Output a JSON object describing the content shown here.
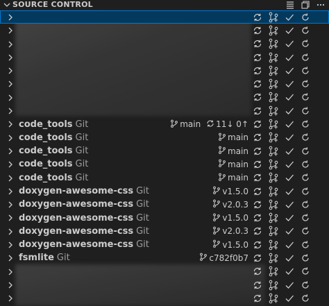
{
  "header": {
    "title": "SOURCE CONTROL"
  },
  "rows": [
    {
      "name": "",
      "kind": "",
      "branch": "",
      "sync": ""
    },
    {
      "name": "",
      "kind": "",
      "branch": "",
      "sync": ""
    },
    {
      "name": "",
      "kind": "",
      "branch": "",
      "sync": ""
    },
    {
      "name": "",
      "kind": "",
      "branch": "",
      "sync": ""
    },
    {
      "name": "",
      "kind": "",
      "branch": "",
      "sync": ""
    },
    {
      "name": "",
      "kind": "",
      "branch": "",
      "sync": ""
    },
    {
      "name": "",
      "kind": "",
      "branch": "",
      "sync": ""
    },
    {
      "name": "",
      "kind": "",
      "branch": "",
      "sync": ""
    },
    {
      "name": "code_tools",
      "kind": "Git",
      "branch": "main",
      "sync": "11↓ 0↑"
    },
    {
      "name": "code_tools",
      "kind": "Git",
      "branch": "main",
      "sync": ""
    },
    {
      "name": "code_tools",
      "kind": "Git",
      "branch": "main",
      "sync": ""
    },
    {
      "name": "code_tools",
      "kind": "Git",
      "branch": "main",
      "sync": ""
    },
    {
      "name": "code_tools",
      "kind": "Git",
      "branch": "main",
      "sync": ""
    },
    {
      "name": "doxygen-awesome-css",
      "kind": "Git",
      "branch": "v1.5.0",
      "sync": ""
    },
    {
      "name": "doxygen-awesome-css",
      "kind": "Git",
      "branch": "v2.0.3",
      "sync": ""
    },
    {
      "name": "doxygen-awesome-css",
      "kind": "Git",
      "branch": "v1.5.0",
      "sync": ""
    },
    {
      "name": "doxygen-awesome-css",
      "kind": "Git",
      "branch": "v2.0.3",
      "sync": ""
    },
    {
      "name": "doxygen-awesome-css",
      "kind": "Git",
      "branch": "v1.5.0",
      "sync": ""
    },
    {
      "name": "fsmlite",
      "kind": "Git",
      "branch": "c782f0b7",
      "sync": ""
    },
    {
      "name": "",
      "kind": "",
      "branch": "",
      "sync": ""
    },
    {
      "name": "",
      "kind": "",
      "branch": "",
      "sync": ""
    },
    {
      "name": "",
      "kind": "",
      "branch": "",
      "sync": ""
    }
  ],
  "colors": {
    "accent": "#0078d4",
    "background": "#1f1f1f",
    "text": "#cccccc",
    "muted": "#9d9d9d"
  },
  "icons": [
    "chevron-down-icon",
    "list-icon",
    "collapse-all-icon",
    "more-icon",
    "chevron-right-icon",
    "git-branch-icon",
    "sync-icon",
    "fetch-icon",
    "branch-graph-icon",
    "commit-check-icon",
    "refresh-icon"
  ]
}
